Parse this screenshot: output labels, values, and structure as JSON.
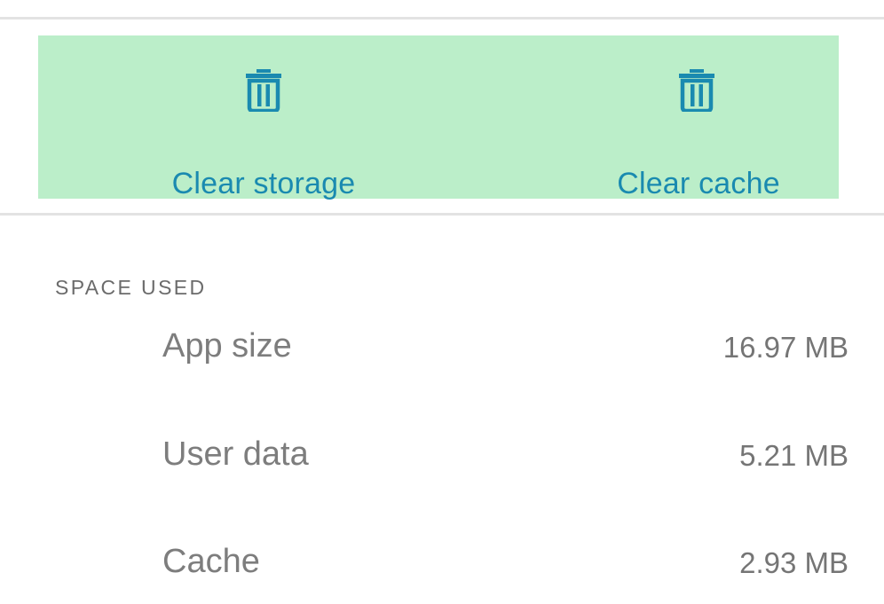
{
  "actions": {
    "clear_storage_label": "Clear storage",
    "clear_cache_label": "Clear cache",
    "icon": "trash-icon"
  },
  "space_used": {
    "header": "SPACE USED",
    "rows": [
      {
        "label": "App size",
        "value": "16.97 MB"
      },
      {
        "label": "User data",
        "value": "5.21 MB"
      },
      {
        "label": "Cache",
        "value": "2.93 MB"
      }
    ]
  },
  "colors": {
    "action_bar_bg": "#bbeec9",
    "accent": "#1a8ab0",
    "divider": "#e3e3e3",
    "row_text": "#7d7d7d",
    "header_text": "#6b6b6b"
  }
}
